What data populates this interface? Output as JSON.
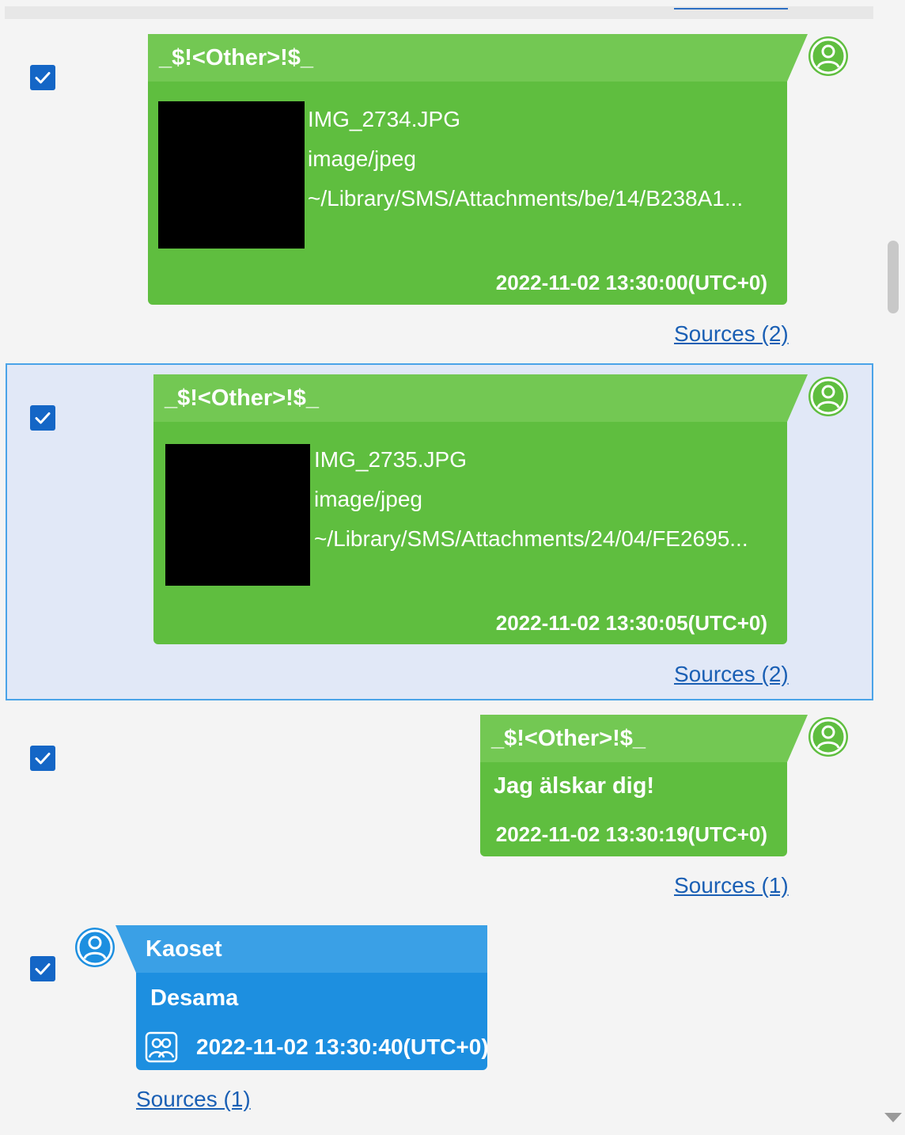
{
  "messages": [
    {
      "sender": "_$!<Other>!$_",
      "direction": "outgoing",
      "checked": true,
      "attachment": {
        "filename": "IMG_2734.JPG",
        "mime": "image/jpeg",
        "path": "~/Library/SMS/Attachments/be/14/B238A1..."
      },
      "timestamp": "2022-11-02 13:30:00(UTC+0)",
      "sources": "Sources (2)"
    },
    {
      "sender": "_$!<Other>!$_",
      "direction": "outgoing",
      "checked": true,
      "selected": true,
      "attachment": {
        "filename": "IMG_2735.JPG",
        "mime": "image/jpeg",
        "path": "~/Library/SMS/Attachments/24/04/FE2695..."
      },
      "timestamp": "2022-11-02 13:30:05(UTC+0)",
      "sources": "Sources (2)"
    },
    {
      "sender": "_$!<Other>!$_",
      "direction": "outgoing",
      "checked": true,
      "text": "Jag älskar dig!",
      "timestamp": "2022-11-02 13:30:19(UTC+0)",
      "sources": "Sources (1)"
    },
    {
      "sender": "Kaoset",
      "direction": "incoming",
      "checked": true,
      "text": "Desama",
      "timestamp": "2022-11-02 13:30:40(UTC+0)",
      "sources": "Sources (1)",
      "icon": "group-chat-icon"
    }
  ],
  "colors": {
    "outgoing_bubble": "#5fbe3f",
    "outgoing_header": "#73c853",
    "incoming_bubble": "#1d8fe0",
    "incoming_header": "#3aa0e6",
    "checkbox": "#1466c6",
    "link": "#1a5fb4",
    "selection_bg": "#e1e8f7",
    "selection_border": "#4aa3e8"
  }
}
